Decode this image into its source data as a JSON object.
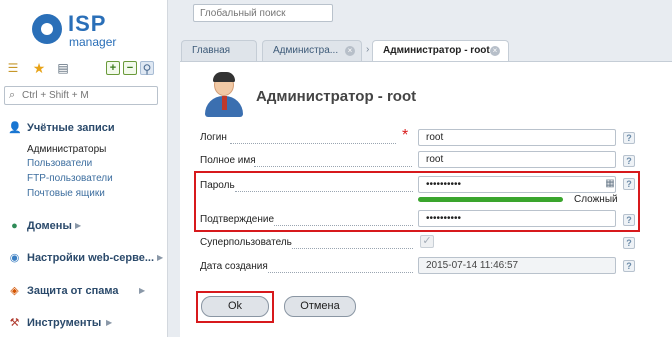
{
  "logo": {
    "brand_top": "ISP",
    "brand_bottom": "manager"
  },
  "sidebar": {
    "search_placeholder": "Ctrl + Shift + M",
    "sections": [
      {
        "label": "Учётные записи",
        "icon": "users-icon",
        "items": [
          "Администраторы",
          "Пользователи",
          "FTP-пользователи",
          "Почтовые ящики"
        ],
        "active_item": "Администраторы"
      },
      {
        "label": "Домены",
        "icon": "globe-icon"
      },
      {
        "label": "Настройки web-серве...",
        "icon": "web-settings-icon"
      },
      {
        "label": "Защита от спама",
        "icon": "shield-icon"
      },
      {
        "label": "Инструменты",
        "icon": "tools-icon"
      }
    ]
  },
  "header": {
    "global_search_placeholder": "Глобальный поиск"
  },
  "tabs": [
    {
      "label": "Главная",
      "closable": false
    },
    {
      "label": "Администра...",
      "closable": true
    },
    {
      "label": "Администратор - root",
      "closable": true,
      "active": true
    }
  ],
  "form": {
    "title": "Администратор - root",
    "fields": {
      "login": {
        "label": "Логин",
        "value": "root",
        "required": true
      },
      "full_name": {
        "label": "Полное имя",
        "value": "root"
      },
      "password": {
        "label": "Пароль",
        "value": "••••••••••"
      },
      "password_strength": {
        "label": "Сложный",
        "level": 0.85,
        "color": "#3aa52d"
      },
      "confirm": {
        "label": "Подтверждение",
        "value": "••••••••••"
      },
      "superuser": {
        "label": "Суперпользователь",
        "checked": true,
        "disabled": true
      },
      "created": {
        "label": "Дата создания",
        "value": "2015-07-14 11:46:57"
      }
    },
    "help_symbol": "?",
    "buttons": {
      "ok": "Ok",
      "cancel": "Отмена"
    }
  },
  "colors": {
    "accent": "#2a6fb8",
    "highlight": "#d7191c",
    "link": "#3d6e9f"
  }
}
